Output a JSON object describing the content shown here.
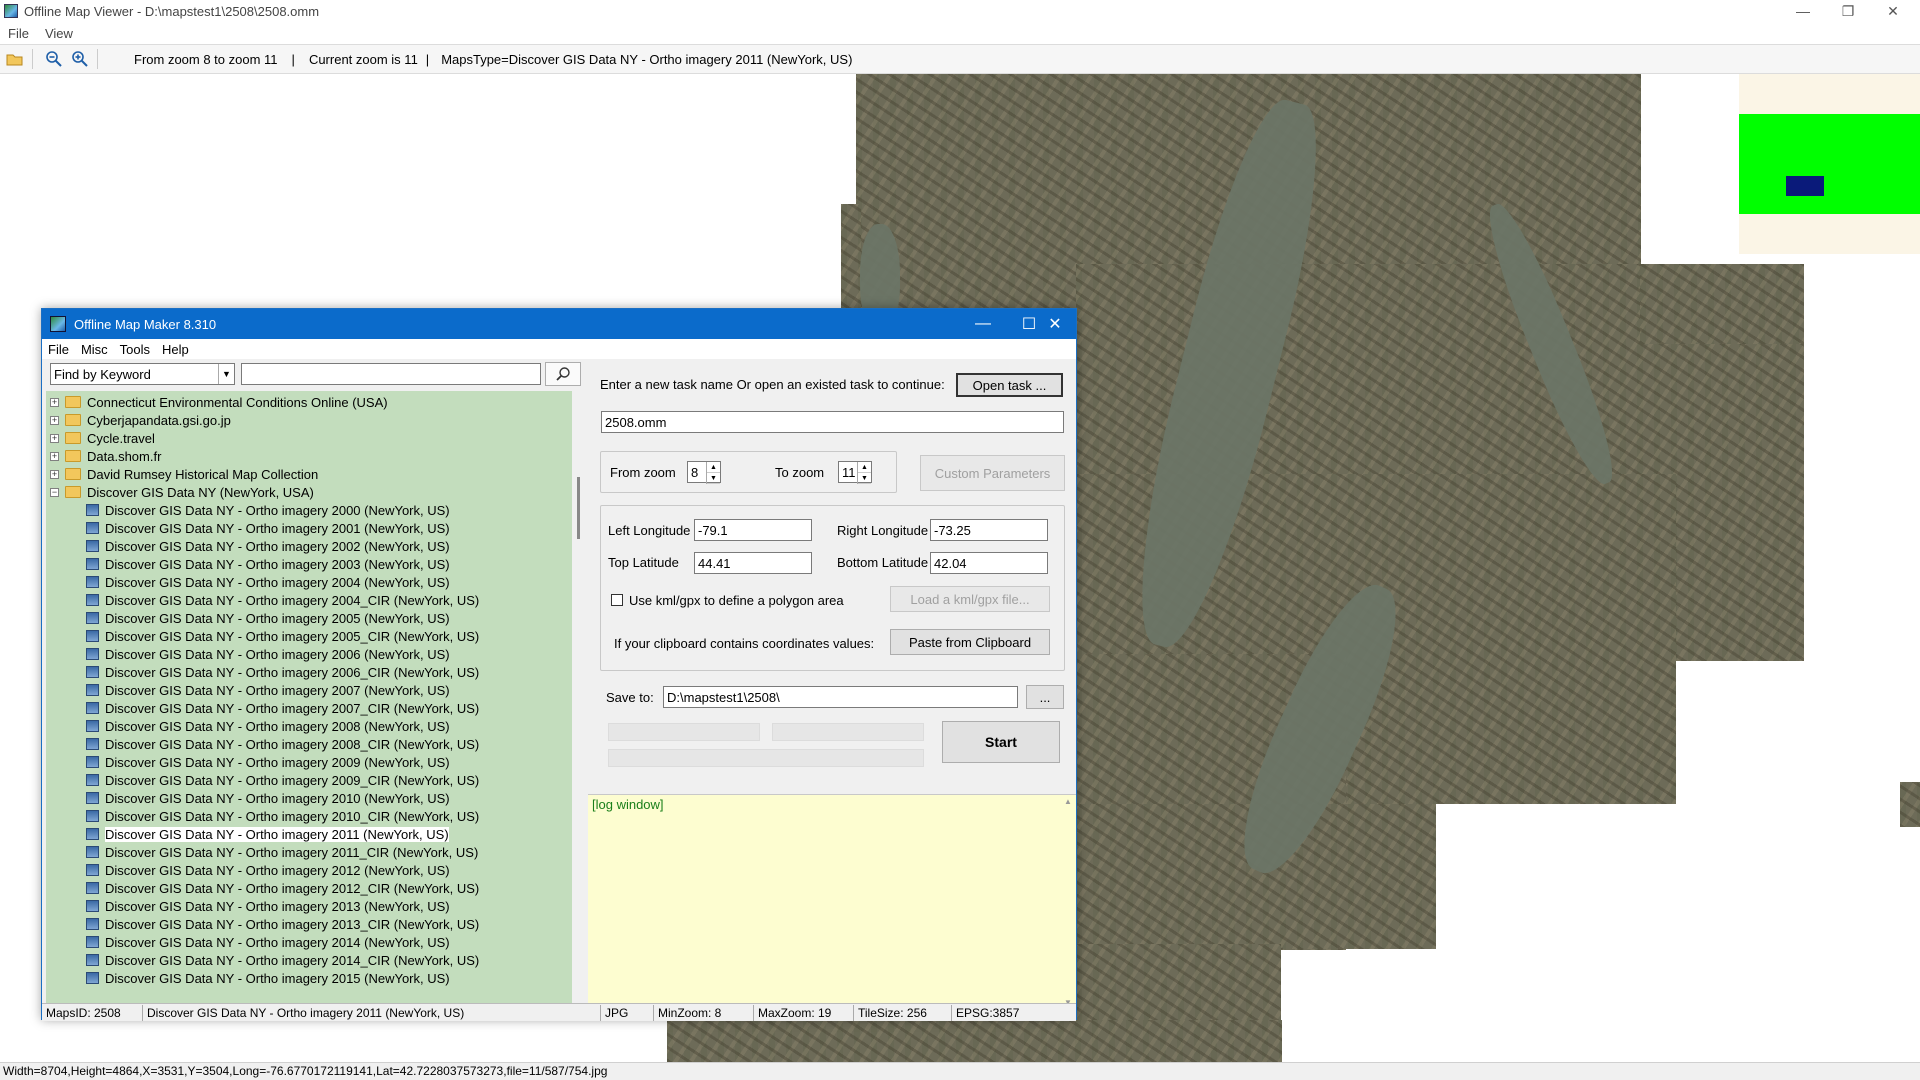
{
  "viewer": {
    "title": "Offline Map Viewer - D:\\mapstest1\\2508\\2508.omm",
    "menu": [
      "File",
      "View"
    ],
    "toolbar": {
      "zoom_range": "From zoom 8 to zoom 11",
      "current_zoom": "Current zoom is 11",
      "maps_type": "MapsType=Discover GIS Data NY - Ortho imagery 2011 (NewYork, US)",
      "separator": "|"
    },
    "status": "Width=8704,Height=4864,X=3531,Y=3504,Long=-76.6770172119141,Lat=42.7228037573273,file=11/587/754.jpg",
    "window_controls": {
      "minimize": "—",
      "maximize": "❐",
      "close": "✕"
    }
  },
  "dialog": {
    "title": "Offline Map Maker 8.310",
    "menu": [
      "File",
      "Misc",
      "Tools",
      "Help"
    ],
    "window_controls": {
      "minimize": "—",
      "maximize": "☐",
      "close": "✕"
    },
    "search": {
      "mode": "Find by Keyword",
      "query": ""
    },
    "tree": {
      "providers": [
        "Connecticut Environmental Conditions Online (USA)",
        "Cyberjapandata.gsi.go.jp",
        "Cycle.travel",
        "Data.shom.fr",
        "David Rumsey Historical Map Collection",
        "Discover GIS Data NY (NewYork, USA)"
      ],
      "layers": [
        "Discover GIS Data NY - Ortho imagery 2000 (NewYork, US)",
        "Discover GIS Data NY - Ortho imagery 2001 (NewYork, US)",
        "Discover GIS Data NY - Ortho imagery 2002 (NewYork, US)",
        "Discover GIS Data NY - Ortho imagery 2003 (NewYork, US)",
        "Discover GIS Data NY - Ortho imagery 2004 (NewYork, US)",
        "Discover GIS Data NY - Ortho imagery 2004_CIR (NewYork, US)",
        "Discover GIS Data NY - Ortho imagery 2005 (NewYork, US)",
        "Discover GIS Data NY - Ortho imagery 2005_CIR (NewYork, US)",
        "Discover GIS Data NY - Ortho imagery 2006 (NewYork, US)",
        "Discover GIS Data NY - Ortho imagery 2006_CIR (NewYork, US)",
        "Discover GIS Data NY - Ortho imagery 2007 (NewYork, US)",
        "Discover GIS Data NY - Ortho imagery 2007_CIR (NewYork, US)",
        "Discover GIS Data NY - Ortho imagery 2008 (NewYork, US)",
        "Discover GIS Data NY - Ortho imagery 2008_CIR (NewYork, US)",
        "Discover GIS Data NY - Ortho imagery 2009 (NewYork, US)",
        "Discover GIS Data NY - Ortho imagery 2009_CIR (NewYork, US)",
        "Discover GIS Data NY - Ortho imagery 2010 (NewYork, US)",
        "Discover GIS Data NY - Ortho imagery 2010_CIR (NewYork, US)",
        "Discover GIS Data NY - Ortho imagery 2011 (NewYork, US)",
        "Discover GIS Data NY - Ortho imagery 2011_CIR (NewYork, US)",
        "Discover GIS Data NY - Ortho imagery 2012 (NewYork, US)",
        "Discover GIS Data NY - Ortho imagery 2012_CIR (NewYork, US)",
        "Discover GIS Data NY - Ortho imagery 2013 (NewYork, US)",
        "Discover GIS Data NY - Ortho imagery 2013_CIR (NewYork, US)",
        "Discover GIS Data NY - Ortho imagery 2014 (NewYork, US)",
        "Discover GIS Data NY - Ortho imagery 2014_CIR (NewYork, US)",
        "Discover GIS Data NY - Ortho imagery 2015 (NewYork, US)"
      ],
      "selected": "Discover GIS Data NY - Ortho imagery 2011 (NewYork, US)"
    },
    "task": {
      "prompt": "Enter a new task name Or open an existed task to continue:",
      "open_button": "Open task ...",
      "name": "2508.omm"
    },
    "zoom": {
      "from_label": "From zoom",
      "from_value": "8",
      "to_label": "To zoom",
      "to_value": "11",
      "custom_button": "Custom Parameters"
    },
    "bounds": {
      "left_label": "Left Longitude",
      "left": "-79.1",
      "right_label": "Right Longitude",
      "right": "-73.25",
      "top_label": "Top Latitude",
      "top": "44.41",
      "bottom_label": "Bottom Latitude",
      "bottom": "42.04",
      "kml_label": "Use kml/gpx to define a polygon area",
      "kml_checked": false,
      "kml_button": "Load a kml/gpx file...",
      "clipboard_label": "If your clipboard contains coordinates values:",
      "clipboard_button": "Paste from Clipboard"
    },
    "save": {
      "label": "Save to:",
      "path": "D:\\mapstest1\\2508\\",
      "browse": "..."
    },
    "start_button": "Start",
    "log": "[log window]",
    "status": {
      "maps_id": "MapsID: 2508",
      "layer": "Discover GIS Data NY - Ortho imagery 2011 (NewYork, US)",
      "format": "JPG",
      "min_zoom": "MinZoom: 8",
      "max_zoom": "MaxZoom: 19",
      "tile_size": "TileSize: 256",
      "epsg": "EPSG:3857"
    }
  },
  "colors": {
    "tree_bg": "#c3ddbd",
    "dialog_title_bg": "#0b6bcb",
    "log_bg": "#fdfdd0",
    "log_text": "#1a7f1a",
    "overview_green": "#00ff00",
    "overview_marker": "#0a1a7a"
  }
}
